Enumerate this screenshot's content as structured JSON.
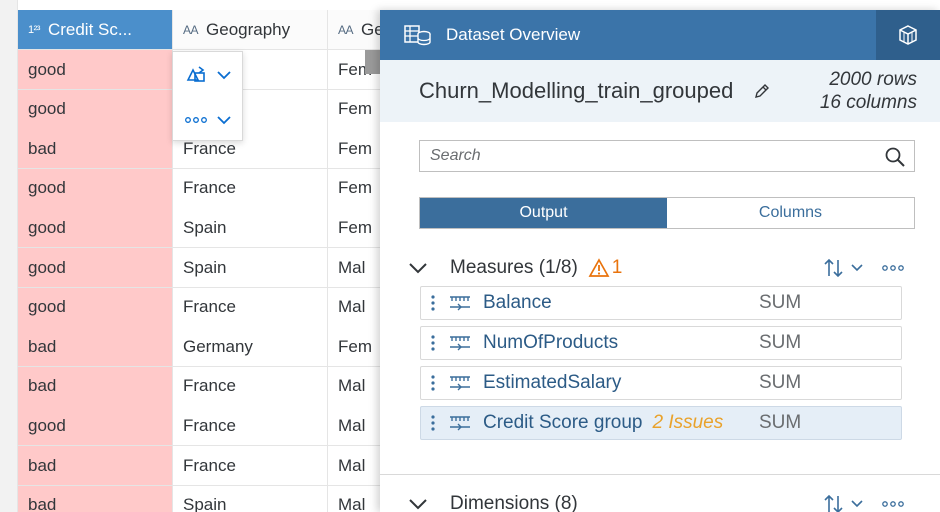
{
  "grid": {
    "columns": [
      {
        "type_label": "1²³",
        "name": "Credit Sc..."
      },
      {
        "type_label": "AA",
        "name": "Geography"
      },
      {
        "type_label": "AA",
        "name": "Ge"
      }
    ],
    "rows": [
      {
        "credit": "good",
        "geo": "",
        "gen": "Fem"
      },
      {
        "credit": "good",
        "geo": "",
        "gen": "Fem"
      },
      {
        "credit": "bad",
        "geo": "France",
        "gen": "Fem"
      },
      {
        "credit": "good",
        "geo": "France",
        "gen": "Fem"
      },
      {
        "credit": "good",
        "geo": "Spain",
        "gen": "Fem"
      },
      {
        "credit": "good",
        "geo": "Spain",
        "gen": "Mal"
      },
      {
        "credit": "good",
        "geo": "France",
        "gen": "Mal"
      },
      {
        "credit": "bad",
        "geo": "Germany",
        "gen": "Fem"
      },
      {
        "credit": "bad",
        "geo": "France",
        "gen": "Mal"
      },
      {
        "credit": "good",
        "geo": "France",
        "gen": "Mal"
      },
      {
        "credit": "bad",
        "geo": "France",
        "gen": "Mal"
      },
      {
        "credit": "bad",
        "geo": "Spain",
        "gen": "Mal"
      }
    ]
  },
  "panel": {
    "title": "Dataset Overview",
    "dataset_name": "Churn_Modelling_train_grouped",
    "rows_text": "2000 rows",
    "columns_text": "16 columns",
    "search_placeholder": "Search",
    "tabs": {
      "output": "Output",
      "columns": "Columns"
    },
    "measures": {
      "title": "Measures (1/8)",
      "warning_count": "1",
      "items": [
        {
          "name": "Balance",
          "issue": "",
          "agg": "SUM"
        },
        {
          "name": "NumOfProducts",
          "issue": "",
          "agg": "SUM"
        },
        {
          "name": "EstimatedSalary",
          "issue": "",
          "agg": "SUM"
        },
        {
          "name": "Credit Score group",
          "issue": "2 Issues",
          "agg": "SUM"
        }
      ]
    },
    "dimensions": {
      "title": "Dimensions (8)"
    }
  },
  "colors": {
    "header_blue": "#3b74a9",
    "selected_column": "#4b8fcb",
    "bad_cell": "#ffc9c9",
    "warning": "#e9730c",
    "issue_text": "#e9a22b"
  }
}
